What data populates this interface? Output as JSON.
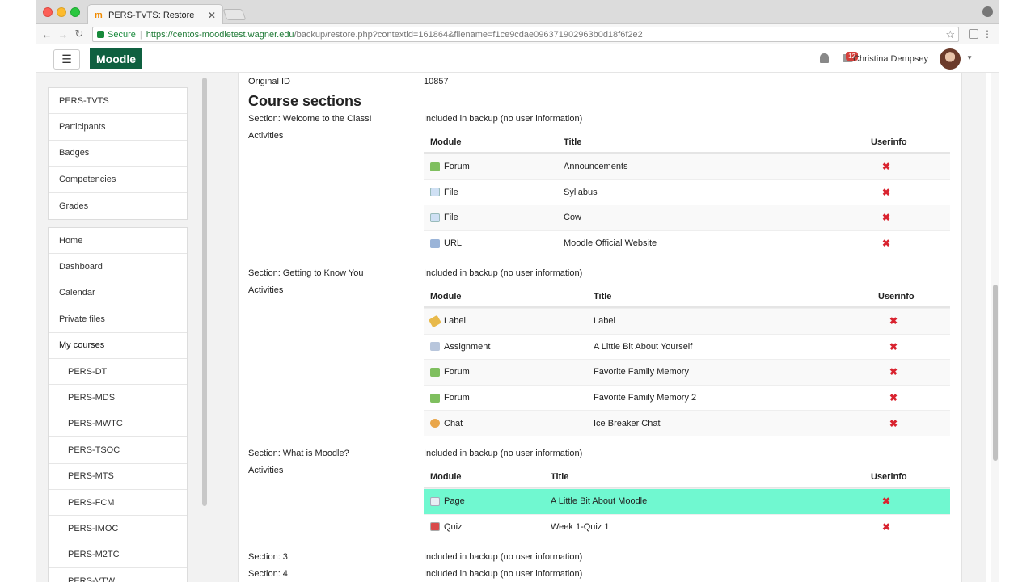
{
  "browser": {
    "tab_title": "PERS-TVTS: Restore",
    "secure_label": "Secure",
    "url_host": "https://centos-moodletest.wagner.edu",
    "url_path": "/backup/restore.php?contextid=161864&filename=f1ce9cdae096371902963b0d18f6f2e2"
  },
  "navbar": {
    "brand": "Moodle",
    "message_count": "12",
    "user_name": "Christina Dempsey"
  },
  "sidebar": {
    "course_items": [
      "PERS-TVTS",
      "Participants",
      "Badges",
      "Competencies",
      "Grades"
    ],
    "site_items": [
      "Home",
      "Dashboard",
      "Calendar",
      "Private files",
      "My courses"
    ],
    "my_courses": [
      "PERS-DT",
      "PERS-MDS",
      "PERS-MWTC",
      "PERS-TSOC",
      "PERS-MTS",
      "PERS-FCM",
      "PERS-IMOC",
      "PERS-M2TC",
      "PERS-VTW"
    ]
  },
  "main": {
    "original_id_label": "Original ID",
    "original_id_value": "10857",
    "heading": "Course sections",
    "activities_label": "Activities",
    "table_headers": {
      "module": "Module",
      "title": "Title",
      "userinfo": "Userinfo"
    },
    "sections": [
      {
        "label": "Section: Welcome to the Class!",
        "status": "Included in backup (no user information)",
        "rows": [
          {
            "module": "Forum",
            "title": "Announcements",
            "icon": "forum-icon"
          },
          {
            "module": "File",
            "title": "Syllabus",
            "icon": "file-icon"
          },
          {
            "module": "File",
            "title": "Cow",
            "icon": "file-icon"
          },
          {
            "module": "URL",
            "title": "Moodle Official Website",
            "icon": "url-icon"
          }
        ]
      },
      {
        "label": "Section: Getting to Know You",
        "status": "Included in backup (no user information)",
        "rows": [
          {
            "module": "Label",
            "title": "Label",
            "icon": "label-icon"
          },
          {
            "module": "Assignment",
            "title": "A Little Bit About Yourself",
            "icon": "assignment-icon"
          },
          {
            "module": "Forum",
            "title": "Favorite Family Memory",
            "icon": "forum-icon"
          },
          {
            "module": "Forum",
            "title": "Favorite Family Memory 2",
            "icon": "forum-icon"
          },
          {
            "module": "Chat",
            "title": "Ice Breaker Chat",
            "icon": "chat-icon"
          }
        ]
      },
      {
        "label": "Section: What is Moodle?",
        "status": "Included in backup (no user information)",
        "rows": [
          {
            "module": "Page",
            "title": "A Little Bit About Moodle",
            "icon": "page-icon"
          },
          {
            "module": "Quiz",
            "title": "Week 1-Quiz 1",
            "icon": "quiz-icon"
          }
        ]
      },
      {
        "label": "Section: 3",
        "status": "Included in backup (no user information)"
      },
      {
        "label": "Section: 4",
        "status": "Included in backup (no user information)"
      }
    ]
  },
  "colors": {
    "brand": "#0f6040",
    "highlight_row": "#70f8d0",
    "remove_x": "#d9232f",
    "secure_green": "#178a3b"
  }
}
